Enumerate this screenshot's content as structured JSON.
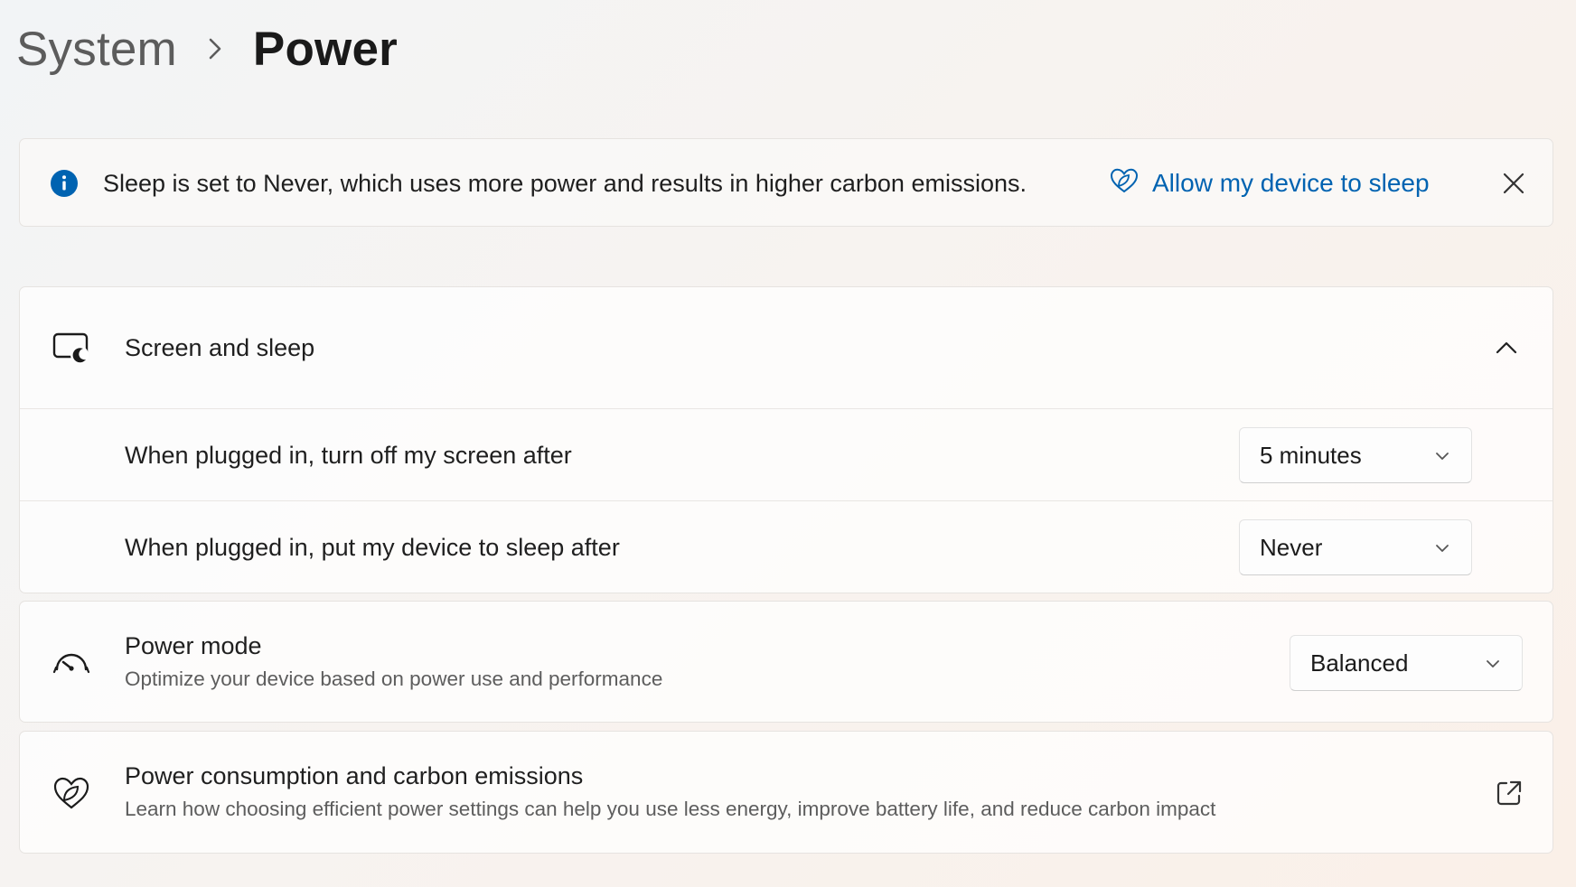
{
  "breadcrumb": {
    "parent": "System",
    "current": "Power"
  },
  "banner": {
    "message": "Sleep is set to Never, which uses more power and results in higher carbon emissions.",
    "action_label": "Allow my device to sleep",
    "icon": "info-icon",
    "accent_color": "#0063b1"
  },
  "screen_and_sleep": {
    "title": "Screen and sleep",
    "expanded": true,
    "rows": [
      {
        "label": "When plugged in, turn off my screen after",
        "value": "5 minutes"
      },
      {
        "label": "When plugged in, put my device to sleep after",
        "value": "Never"
      }
    ]
  },
  "power_mode": {
    "title": "Power mode",
    "subtitle": "Optimize your device based on power use and performance",
    "value": "Balanced"
  },
  "emissions": {
    "title": "Power consumption and carbon emissions",
    "subtitle": "Learn how choosing efficient power settings can help you use less energy, improve battery life, and reduce carbon impact"
  }
}
